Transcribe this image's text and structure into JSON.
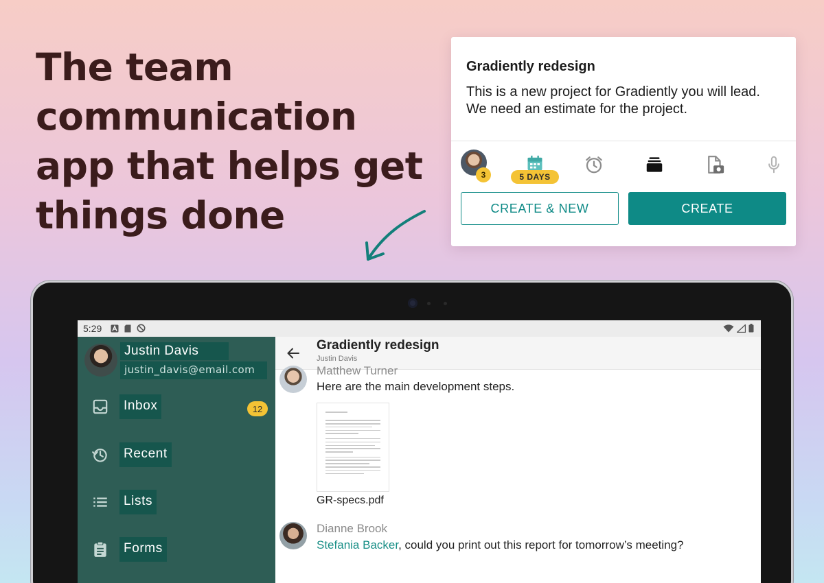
{
  "hero": {
    "headline": "The team communication app that helps get things done"
  },
  "task_card": {
    "title": "Gradiently redesign",
    "body": "This is a new project for Gradiently you will lead. We need an estimate for the project.",
    "assignee_count": "3",
    "due_badge": "5 DAYS",
    "create_new_label": "CREATE & NEW",
    "create_label": "CREATE",
    "colors": {
      "accent": "#0e8a86",
      "badge": "#f4c335"
    }
  },
  "device": {
    "status_bar": {
      "time": "5:29"
    },
    "drawer": {
      "user_name": "Justin Davis",
      "user_email": "justin_davis@email.com",
      "items": [
        {
          "label": "Inbox",
          "icon": "inbox-icon",
          "badge": "12"
        },
        {
          "label": "Recent",
          "icon": "history-icon"
        },
        {
          "label": "Lists",
          "icon": "list-icon"
        },
        {
          "label": "Forms",
          "icon": "clipboard-icon"
        }
      ],
      "colors": {
        "background": "#2e5d55",
        "highlight": "#16564d"
      }
    },
    "chat": {
      "title": "Gradiently redesign",
      "subtitle": "Justin Davis",
      "messages": [
        {
          "author": "Matthew Turner",
          "text": "Here are the main development steps.",
          "attachment_name": "GR-specs.pdf"
        },
        {
          "author": "Dianne Brook",
          "mention": "Stefania Backer",
          "text": ", could you print out this report for tomorrow’s meeting?"
        }
      ]
    }
  }
}
